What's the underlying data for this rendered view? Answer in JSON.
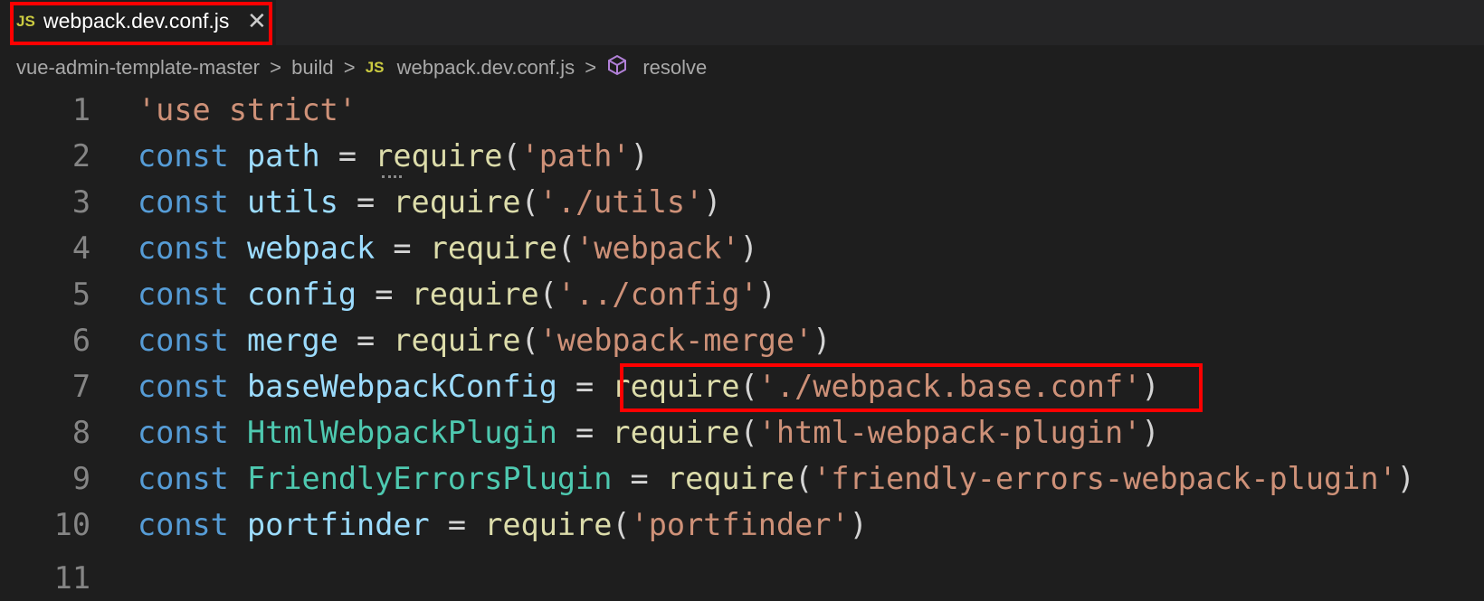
{
  "tab": {
    "icon_label": "JS",
    "title": "webpack.dev.conf.js",
    "close_glyph": "✕"
  },
  "breadcrumb": {
    "items": [
      "vue-admin-template-master",
      "build",
      "webpack.dev.conf.js",
      "resolve"
    ],
    "separator": ">",
    "file_icon_label": "JS",
    "symbol_icon": "cube-icon"
  },
  "editor": {
    "lines": [
      {
        "n": "1",
        "tokens": [
          [
            "str",
            "'use strict'"
          ]
        ]
      },
      {
        "n": "2",
        "tokens": [
          [
            "kw",
            "const"
          ],
          [
            "op",
            " "
          ],
          [
            "var",
            "path"
          ],
          [
            "op",
            " = "
          ],
          [
            "fn",
            "require"
          ],
          [
            "op",
            "("
          ],
          [
            "str",
            "'path'"
          ],
          [
            "op",
            ")"
          ]
        ]
      },
      {
        "n": "3",
        "tokens": [
          [
            "kw",
            "const"
          ],
          [
            "op",
            " "
          ],
          [
            "var",
            "utils"
          ],
          [
            "op",
            " = "
          ],
          [
            "fn",
            "require"
          ],
          [
            "op",
            "("
          ],
          [
            "str",
            "'./utils'"
          ],
          [
            "op",
            ")"
          ]
        ]
      },
      {
        "n": "4",
        "tokens": [
          [
            "kw",
            "const"
          ],
          [
            "op",
            " "
          ],
          [
            "var",
            "webpack"
          ],
          [
            "op",
            " = "
          ],
          [
            "fn",
            "require"
          ],
          [
            "op",
            "("
          ],
          [
            "str",
            "'webpack'"
          ],
          [
            "op",
            ")"
          ]
        ]
      },
      {
        "n": "5",
        "tokens": [
          [
            "kw",
            "const"
          ],
          [
            "op",
            " "
          ],
          [
            "var",
            "config"
          ],
          [
            "op",
            " = "
          ],
          [
            "fn",
            "require"
          ],
          [
            "op",
            "("
          ],
          [
            "str",
            "'../config'"
          ],
          [
            "op",
            ")"
          ]
        ]
      },
      {
        "n": "6",
        "tokens": [
          [
            "kw",
            "const"
          ],
          [
            "op",
            " "
          ],
          [
            "var",
            "merge"
          ],
          [
            "op",
            " = "
          ],
          [
            "fn",
            "require"
          ],
          [
            "op",
            "("
          ],
          [
            "str",
            "'webpack-merge'"
          ],
          [
            "op",
            ")"
          ]
        ]
      },
      {
        "n": "7",
        "tokens": [
          [
            "kw",
            "const"
          ],
          [
            "op",
            " "
          ],
          [
            "var",
            "baseWebpackConfig"
          ],
          [
            "op",
            " = "
          ],
          [
            "fn",
            "require"
          ],
          [
            "op",
            "("
          ],
          [
            "str",
            "'./webpack.base.conf'"
          ],
          [
            "op",
            ")"
          ]
        ]
      },
      {
        "n": "8",
        "tokens": [
          [
            "kw",
            "const"
          ],
          [
            "op",
            " "
          ],
          [
            "cls",
            "HtmlWebpackPlugin"
          ],
          [
            "op",
            " = "
          ],
          [
            "fn",
            "require"
          ],
          [
            "op",
            "("
          ],
          [
            "str",
            "'html-webpack-plugin'"
          ],
          [
            "op",
            ")"
          ]
        ]
      },
      {
        "n": "9",
        "tokens": [
          [
            "kw",
            "const"
          ],
          [
            "op",
            " "
          ],
          [
            "cls",
            "FriendlyErrorsPlugin"
          ],
          [
            "op",
            " = "
          ],
          [
            "fn",
            "require"
          ],
          [
            "op",
            "("
          ],
          [
            "str",
            "'friendly-errors-webpack-plugin'"
          ],
          [
            "op",
            ")"
          ]
        ]
      },
      {
        "n": "10",
        "tokens": [
          [
            "kw",
            "const"
          ],
          [
            "op",
            " "
          ],
          [
            "var",
            "portfinder"
          ],
          [
            "op",
            " = "
          ],
          [
            "fn",
            "require"
          ],
          [
            "op",
            "("
          ],
          [
            "str",
            "'portfinder'"
          ],
          [
            "op",
            ")"
          ]
        ]
      },
      {
        "n": "11",
        "tokens": []
      }
    ]
  },
  "colors": {
    "highlight_box": "#ff0000",
    "keyword": "#569cd6",
    "variable": "#9cdcfe",
    "class": "#4ec9b0",
    "function": "#dcdcaa",
    "string": "#ce9178"
  }
}
